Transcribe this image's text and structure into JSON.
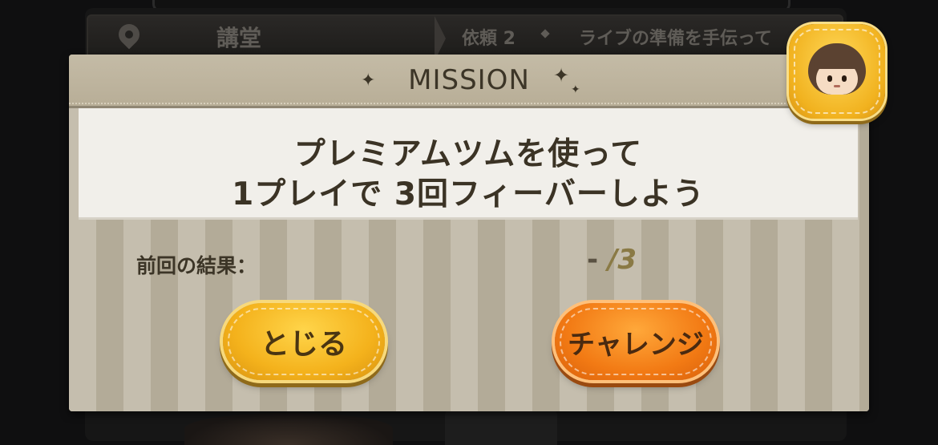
{
  "background": {
    "location_name": "講堂",
    "request_number": "依頼 2",
    "request_text": "ライブの準備を手伝って"
  },
  "dialog": {
    "title": "MISSION",
    "mission_lines": [
      "プレミアムツムを使って",
      "1プレイで 3回フィーバーしよう"
    ],
    "result_label": "前回の結果：",
    "result_current": "-",
    "result_total": "/3",
    "buttons": {
      "close_label": "とじる",
      "challenge_label": "チャレンジ"
    }
  },
  "colors": {
    "dialog_bg": "#bfb8a7",
    "close_button": "#f4b21c",
    "challenge_button": "#f27a14",
    "text_dark": "#3c3527"
  },
  "icons": [
    "location-pin-icon",
    "sparkle-icon",
    "character-avatar-icon"
  ]
}
